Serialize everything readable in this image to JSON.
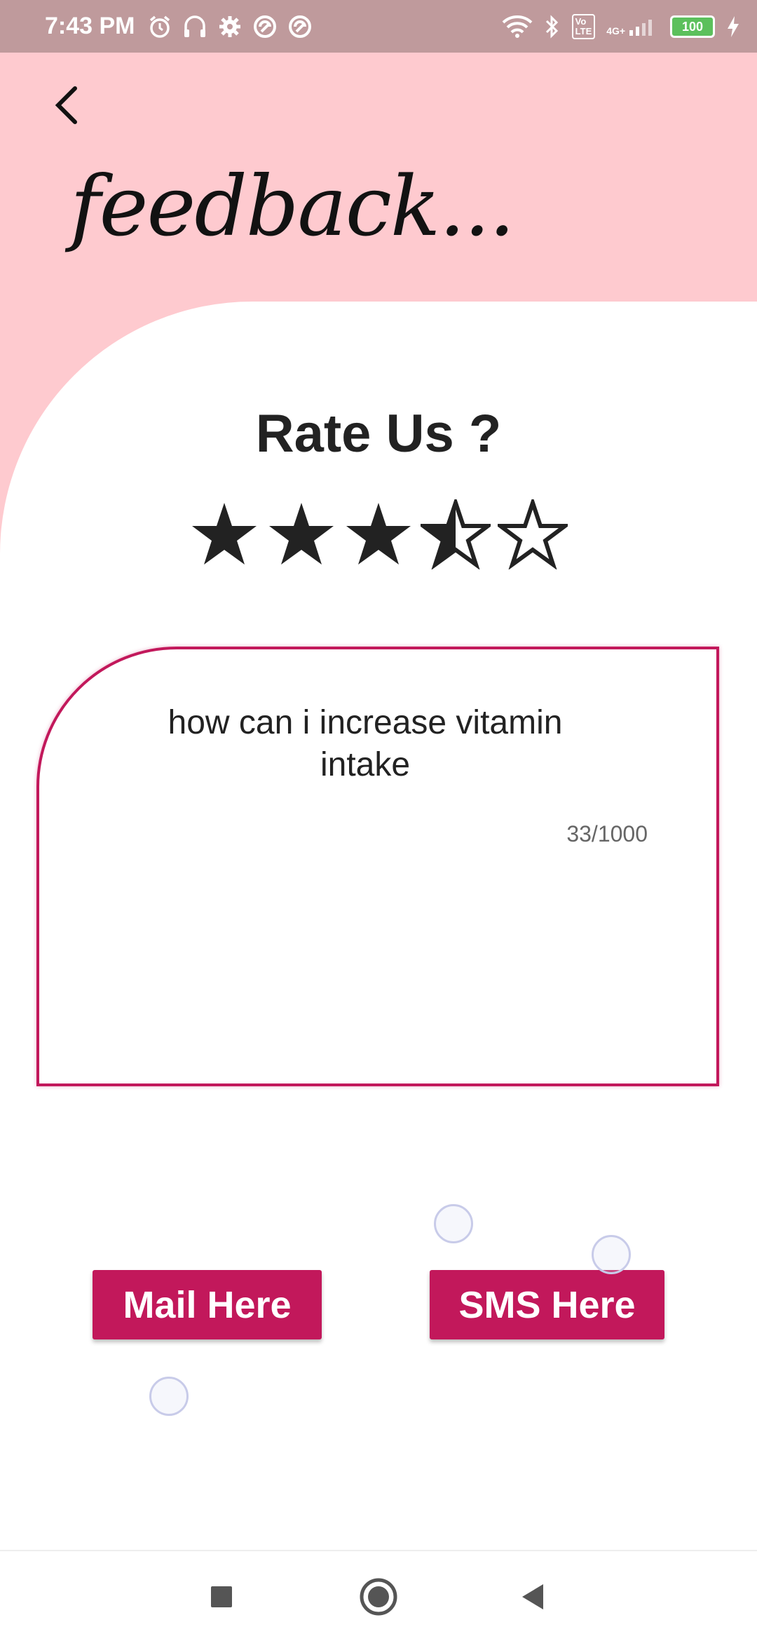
{
  "status_bar": {
    "time": "7:43 PM",
    "left_icons": [
      "alarm-icon",
      "headset-icon",
      "settings-icon",
      "vpn-icon",
      "vpn-icon"
    ],
    "right_icons": [
      "wifi-icon",
      "bluetooth-icon",
      "volte-icon",
      "signal-icon",
      "battery-icon",
      "charging-icon"
    ],
    "volte_label": "Vo\nLTE",
    "network_label": "4G+",
    "battery_level": "100"
  },
  "header": {
    "back_icon": "chevron-left-icon",
    "title": "feedback...",
    "background_color": "#fecacf"
  },
  "rating": {
    "title": "Rate Us ?",
    "value": 3.5,
    "max": 5
  },
  "feedback": {
    "text": "how can i increase vitamin intake",
    "char_count": "33/1000",
    "border_color": "#c2185b"
  },
  "buttons": {
    "mail_label": "Mail Here",
    "sms_label": "SMS Here",
    "color": "#c2185b"
  },
  "nav_bar": {
    "icons": [
      "recents-icon",
      "home-icon",
      "back-icon"
    ]
  }
}
